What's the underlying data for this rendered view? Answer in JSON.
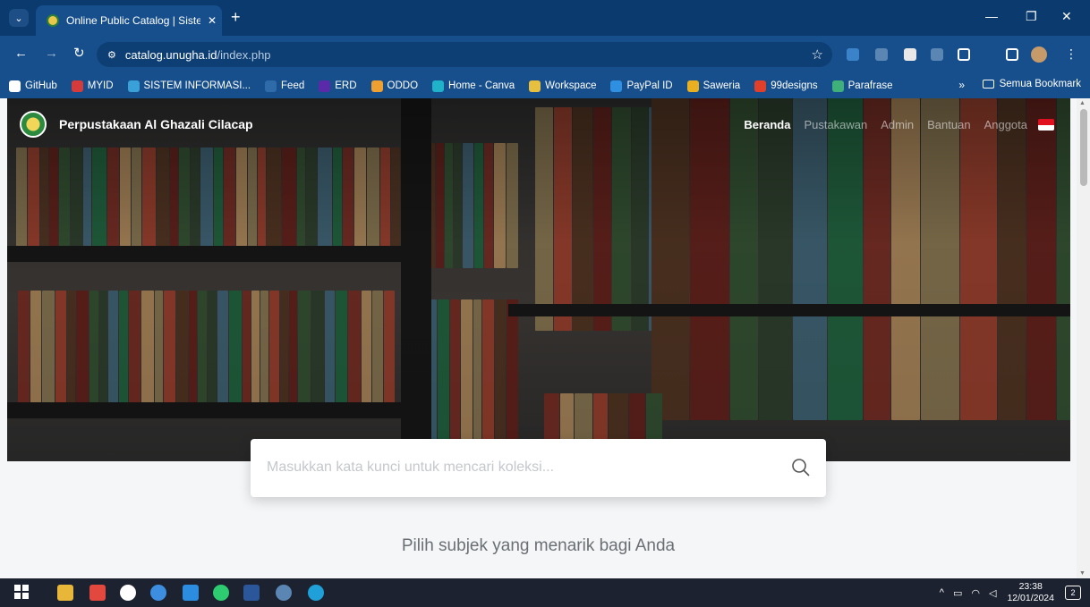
{
  "browser": {
    "tab_title": "Online Public Catalog | Sistem /",
    "url_host": "catalog.unugha.id",
    "url_path": "/index.php",
    "new_tab": "+",
    "close_tab": "✕"
  },
  "bookmarks": {
    "items": [
      {
        "label": "GitHub",
        "color": "#ffffff"
      },
      {
        "label": "MYID",
        "color": "#d63b3b"
      },
      {
        "label": "SISTEM INFORMASI...",
        "color": "#3aa0d8"
      },
      {
        "label": "Feed",
        "color": "#2e6ba8"
      },
      {
        "label": "ERD",
        "color": "#5a2aa8"
      },
      {
        "label": "ODDO",
        "color": "#f0a030"
      },
      {
        "label": "Home - Canva",
        "color": "#20b2c8"
      },
      {
        "label": "Workspace",
        "color": "#e8c040"
      },
      {
        "label": "PayPal ID",
        "color": "#2f8fe0"
      },
      {
        "label": "Saweria",
        "color": "#e8b020"
      },
      {
        "label": "99designs",
        "color": "#e0402a"
      },
      {
        "label": "Parafrase",
        "color": "#3fb07a"
      }
    ],
    "more": "»",
    "folder_label": "Semua Bookmark"
  },
  "site": {
    "brand_name": "Perpustakaan Al Ghazali Cilacap",
    "nav": [
      {
        "label": "Beranda",
        "active": true
      },
      {
        "label": "Pustakawan",
        "active": false
      },
      {
        "label": "Admin",
        "active": false
      },
      {
        "label": "Bantuan",
        "active": false
      },
      {
        "label": "Anggota",
        "active": false
      }
    ],
    "search_placeholder": "Masukkan kata kunci untuk mencari koleksi...",
    "subject_title": "Pilih subjek yang menarik bagi Anda"
  },
  "taskbar": {
    "time": "23:38",
    "date": "12/01/2024",
    "notifications": "2",
    "tray_arrow": "^"
  }
}
